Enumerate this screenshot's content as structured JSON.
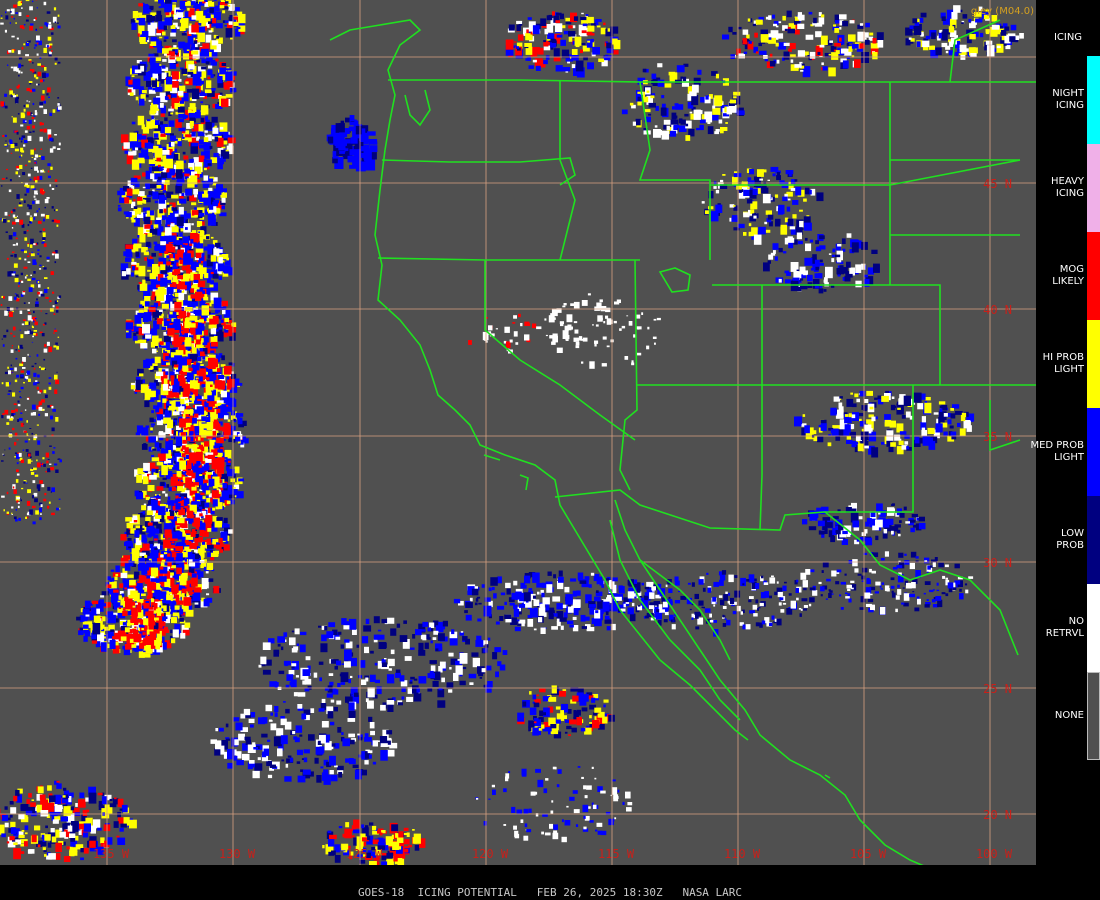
{
  "title_bar": {
    "satellite": "GOES-18",
    "product": "ICING POTENTIAL",
    "datetime": "FEB 26, 2025 18:30Z",
    "agency": "NASA LARC",
    "full": "GOES-18  ICING POTENTIAL   FEB 26, 2025 18:30Z   NASA LARC"
  },
  "credit": "gley (M04.0)",
  "legend": {
    "title": "ICING",
    "items": [
      {
        "label": "NIGHT\nICING",
        "color": "#00ffff"
      },
      {
        "label": "HEAVY\nICING",
        "color": "#f0b0e8"
      },
      {
        "label": "MOG\nLIKELY",
        "color": "#ff0000"
      },
      {
        "label": "HI PROB\nLIGHT",
        "color": "#ffff00"
      },
      {
        "label": "MED PROB\nLIGHT",
        "color": "#0000ff"
      },
      {
        "label": "LOW\nPROB",
        "color": "#000080"
      },
      {
        "label": "NO\nRETRVL",
        "color": "#ffffff"
      },
      {
        "label": "NONE",
        "color": "#505050"
      }
    ]
  },
  "map": {
    "background_color": "#505050",
    "grid_color": "#d8a080",
    "border_color": "#20ff20",
    "latitude_labels": [
      "45 N",
      "40 N",
      "35 N",
      "30 N",
      "25 N",
      "20 N"
    ],
    "longitude_labels": [
      "135 W",
      "130 W",
      "125 W",
      "120 W",
      "115 W",
      "110 W",
      "105 W",
      "100 W"
    ]
  }
}
